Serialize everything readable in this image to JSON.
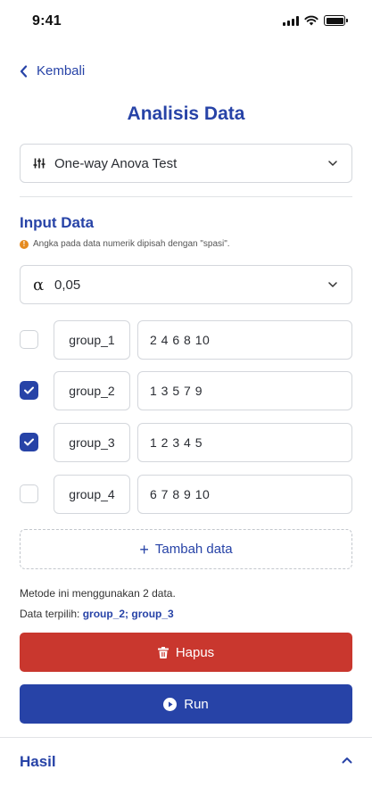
{
  "status": {
    "time": "9:41"
  },
  "nav": {
    "back_label": "Kembali"
  },
  "page": {
    "title": "Analisis Data"
  },
  "test_select": {
    "value": "One-way Anova Test"
  },
  "input_section": {
    "title": "Input Data",
    "hint": "Angka pada data numerik dipisah dengan \"spasi\"."
  },
  "alpha": {
    "symbol": "α",
    "value": "0,05"
  },
  "groups": [
    {
      "name": "group_1",
      "values": "2 4 6 8 10",
      "checked": false
    },
    {
      "name": "group_2",
      "values": "1 3 5 7 9",
      "checked": true
    },
    {
      "name": "group_3",
      "values": "1 2 3 4 5",
      "checked": true
    },
    {
      "name": "group_4",
      "values": "6 7 8 9 10",
      "checked": false
    }
  ],
  "add_data": {
    "label": "Tambah data"
  },
  "summary": {
    "method_text": "Metode ini menggunakan 2 data.",
    "selected_prefix": "Data terpilih:",
    "selected_value": "group_2; group_3"
  },
  "actions": {
    "delete_label": "Hapus",
    "run_label": "Run"
  },
  "result": {
    "title": "Hasil"
  },
  "colors": {
    "accent": "#2743a7",
    "danger": "#c9372e",
    "warning": "#e58a1f"
  }
}
